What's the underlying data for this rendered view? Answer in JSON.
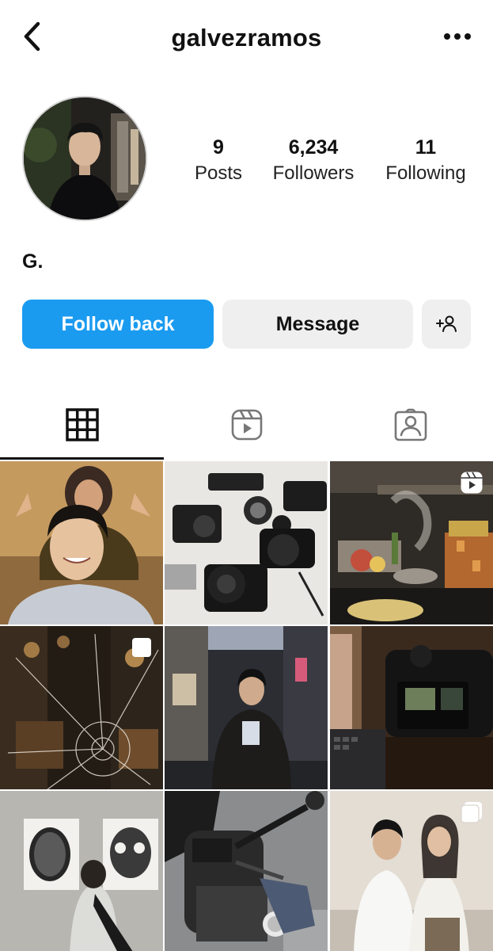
{
  "header": {
    "username": "galvezramos"
  },
  "profile": {
    "display_name": "G."
  },
  "stats": [
    {
      "value": "9",
      "label": "Posts"
    },
    {
      "value": "6,234",
      "label": "Followers"
    },
    {
      "value": "11",
      "label": "Following"
    }
  ],
  "actions": {
    "follow_label": "Follow back",
    "message_label": "Message"
  },
  "tabs": [
    {
      "icon": "grid-icon",
      "active": true
    },
    {
      "icon": "reels-icon",
      "active": false
    },
    {
      "icon": "tagged-icon",
      "active": false
    }
  ],
  "posts": [
    {
      "subject": "portrait",
      "badge": null
    },
    {
      "subject": "cameras",
      "badge": null
    },
    {
      "subject": "kitchen",
      "badge": "reel-icon"
    },
    {
      "subject": "broken-glass",
      "badge": "carousel-icon"
    },
    {
      "subject": "street-portrait",
      "badge": null
    },
    {
      "subject": "camera-laptop",
      "badge": null
    },
    {
      "subject": "gallery",
      "badge": null
    },
    {
      "subject": "motorcycle",
      "badge": null
    },
    {
      "subject": "couple",
      "badge": "carousel-icon"
    }
  ],
  "colors": {
    "accent": "#1a9bf0",
    "secondary_button": "#efefef"
  }
}
